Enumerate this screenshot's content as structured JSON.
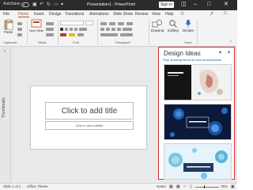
{
  "titlebar": {
    "autosave_label": "AutoSave",
    "autosave_state": "off",
    "doc_title": "Presentation1 - PowerPoint",
    "signin_label": "Sign in"
  },
  "ribbon_tabs": [
    "File",
    "Home",
    "Insert",
    "Design",
    "Transitions",
    "Animations",
    "Slide Show",
    "Review",
    "View",
    "Help"
  ],
  "active_tab": "Home",
  "ribbon": {
    "paste_label": "Paste",
    "new_slide_label": "New Slide",
    "drawing_label": "Drawing",
    "editing_label": "Editing",
    "dictate_label": "Dictate",
    "groups": {
      "clipboard": "Clipboard",
      "slides": "Slides",
      "font": "Font",
      "paragraph": "Paragraph",
      "voice": "Voice"
    }
  },
  "left_rail": {
    "label": "Thumbnails"
  },
  "slide": {
    "title_placeholder": "Click to add title",
    "subtitle_placeholder": "Click to add subtitle"
  },
  "design_ideas": {
    "title": "Design Ideas",
    "link": "Stop showing ideas for new presentations",
    "cards": [
      {
        "style": "dark abstract"
      },
      {
        "style": "blue virus"
      },
      {
        "style": "light blue particles"
      }
    ]
  },
  "status": {
    "slide_counter": "Slide 1 of 1",
    "theme": "Office Theme",
    "notes": "Notes",
    "zoom": "75%"
  },
  "colors": {
    "accent": "#b7472a",
    "titlebar": "#2b2b2b",
    "pane_border": "#d32f2f"
  }
}
